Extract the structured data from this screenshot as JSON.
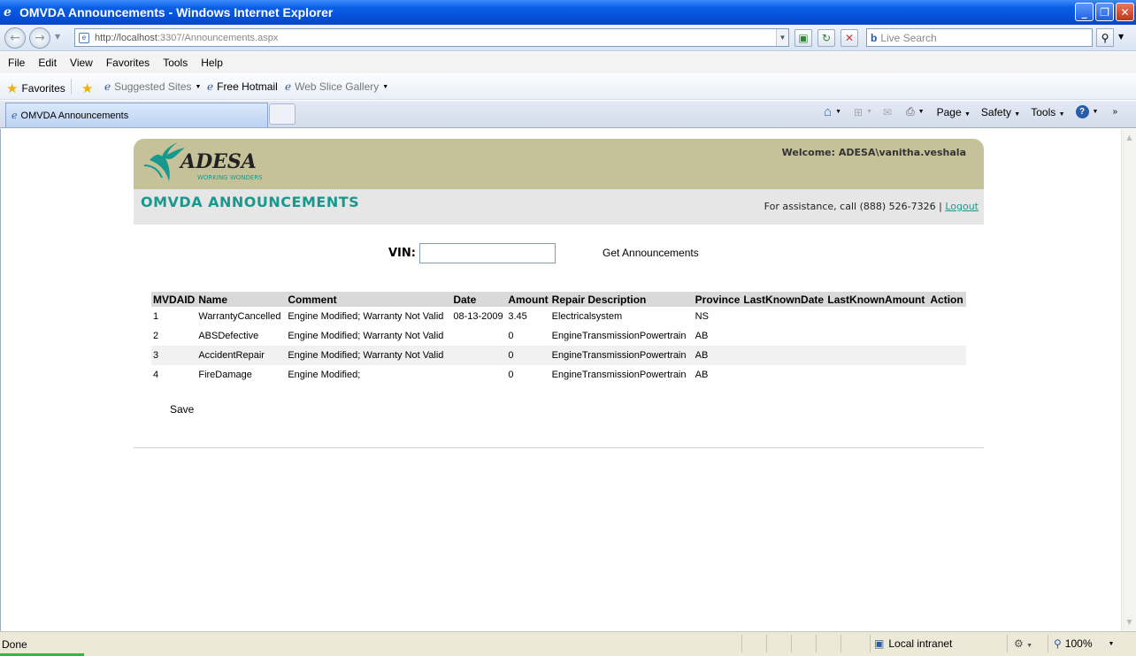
{
  "window": {
    "title": "OMVDA Announcements - Windows Internet Explorer"
  },
  "addressbar": {
    "url_host": "http://localhost",
    "url_rest": ":3307/Announcements.aspx",
    "search_placeholder": "Live Search"
  },
  "menu": [
    "File",
    "Edit",
    "View",
    "Favorites",
    "Tools",
    "Help"
  ],
  "favorites": {
    "label": "Favorites",
    "suggested": "Suggested Sites",
    "hotmail": "Free Hotmail",
    "webslice": "Web Slice Gallery"
  },
  "tab": {
    "label": "OMVDA Announcements"
  },
  "commandbar": {
    "page": "Page",
    "safety": "Safety",
    "tools": "Tools"
  },
  "header": {
    "logo_text": "ADESA",
    "tagline": "WORKING WONDERS",
    "welcome": "Welcome: ADESA\\vanitha.veshala"
  },
  "subheader": {
    "title": "OMVDA ANNOUNCEMENTS",
    "assist_text": "For assistance, call (888) 526-7326 |",
    "logout": "Logout"
  },
  "form": {
    "vin_label": "VIN:",
    "vin_value": "",
    "get_button": "Get Announcements",
    "save_button": "Save"
  },
  "table": {
    "headers": [
      "MVDAID",
      "Name",
      "Comment",
      "Date",
      "Amount",
      "Repair Description",
      "Province",
      "LastKnownDate",
      "LastKnownAmount",
      "Action"
    ],
    "rows": [
      [
        "1",
        "WarrantyCancelled",
        "Engine Modified; Warranty Not Valid",
        "08-13-2009",
        "3.45",
        "Electricalsystem",
        "NS",
        "",
        "",
        ""
      ],
      [
        "2",
        "ABSDefective",
        "Engine Modified; Warranty Not Valid",
        "",
        "0",
        "EngineTransmissionPowertrain",
        "AB",
        "",
        "",
        ""
      ],
      [
        "3",
        "AccidentRepair",
        "Engine Modified; Warranty Not Valid",
        "",
        "0",
        "EngineTransmissionPowertrain",
        "AB",
        "",
        "",
        ""
      ],
      [
        "4",
        "FireDamage",
        "Engine Modified;",
        "",
        "0",
        "EngineTransmissionPowertrain",
        "AB",
        "",
        "",
        ""
      ]
    ]
  },
  "status": {
    "text": "Done",
    "zone": "Local intranet",
    "zoom": "100%"
  },
  "colors": {
    "accent": "#17998e",
    "header_bg": "#c5c29a",
    "subheader_bg": "#e6e6e6",
    "titlebar": "#0a5fe6"
  }
}
